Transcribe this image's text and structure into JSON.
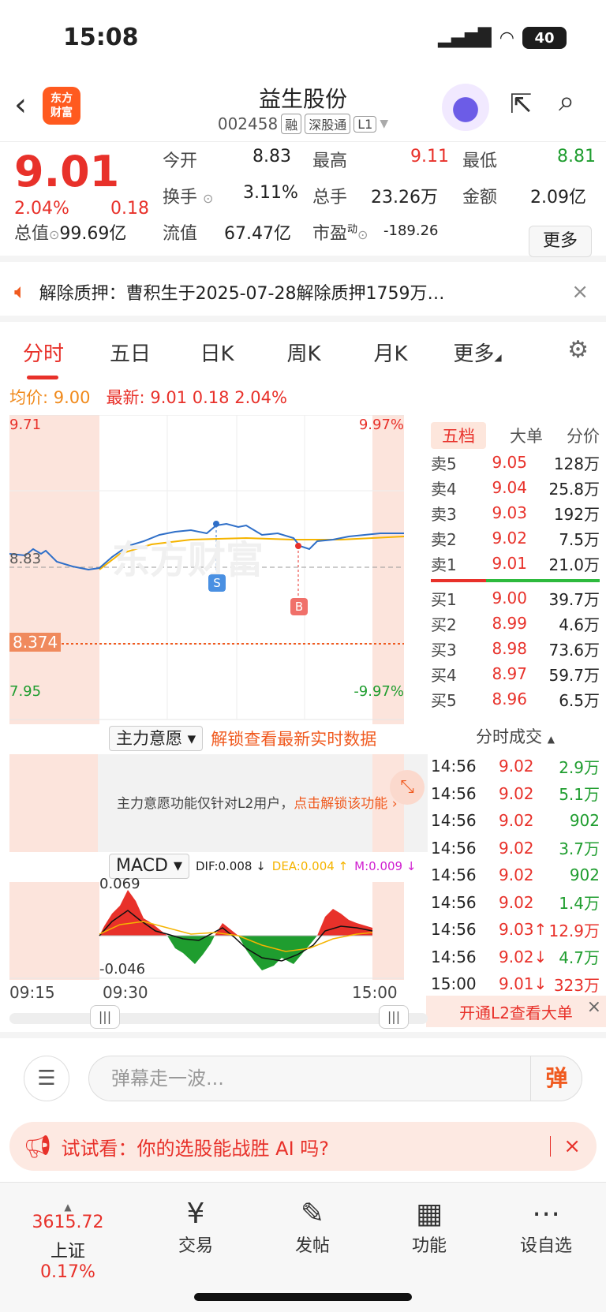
{
  "status": {
    "time": "15:08",
    "battery": "40"
  },
  "header": {
    "back_icon": "chevron-left-icon",
    "logo_text": "东方财富",
    "title": "益生股份",
    "code": "002458",
    "tags": [
      "融",
      "深股通",
      "L1"
    ]
  },
  "quote": {
    "price": "9.01",
    "pct": "2.04%",
    "change": "0.18",
    "open_label": "今开",
    "open": "8.83",
    "high_label": "最高",
    "high": "9.11",
    "low_label": "最低",
    "low": "8.81",
    "turnover_label": "换手",
    "turnover": "3.11%",
    "volume_label": "总手",
    "volume": "23.26万",
    "amount_label": "金额",
    "amount": "2.09亿",
    "mktcap_label": "总值",
    "mktcap": "99.69亿",
    "float_label": "流值",
    "float": "67.47亿",
    "pe_label": "市盈",
    "pe_sup": "动",
    "pe": "-189.26",
    "more_label": "更多"
  },
  "notice": {
    "text": "解除质押：曹积生于2025-07-28解除质押1759万…",
    "close": "×"
  },
  "tabs": [
    "分时",
    "五日",
    "日K",
    "周K",
    "月K",
    "更多"
  ],
  "avg": {
    "avg_label": "均价:",
    "avg": "9.00",
    "last_label": "最新:",
    "last": "9.01",
    "chg": "0.18",
    "pct": "2.04%"
  },
  "chart_labels": {
    "top_left": "9.71",
    "top_right": "9.97%",
    "bottom_left": "7.95",
    "bottom_right": "-9.97%",
    "pre_close": "8.83",
    "cost_line": "8.374",
    "s_mark": "S",
    "b_mark": "B"
  },
  "book": {
    "tabs": [
      "五档",
      "大单",
      "分价"
    ],
    "sells": [
      {
        "k": "卖5",
        "p": "9.05",
        "v": "128万"
      },
      {
        "k": "卖4",
        "p": "9.04",
        "v": "25.8万"
      },
      {
        "k": "卖3",
        "p": "9.03",
        "v": "192万"
      },
      {
        "k": "卖2",
        "p": "9.02",
        "v": "7.5万"
      },
      {
        "k": "卖1",
        "p": "9.01",
        "v": "21.0万"
      }
    ],
    "buys": [
      {
        "k": "买1",
        "p": "9.00",
        "v": "39.7万"
      },
      {
        "k": "买2",
        "p": "8.99",
        "v": "4.6万"
      },
      {
        "k": "买3",
        "p": "8.98",
        "v": "73.6万"
      },
      {
        "k": "买4",
        "p": "8.97",
        "v": "59.7万"
      },
      {
        "k": "买5",
        "p": "8.96",
        "v": "6.5万"
      }
    ]
  },
  "trades": {
    "title": "分时成交",
    "rows": [
      {
        "t": "14:56",
        "p": "9.02",
        "v": "2.9万",
        "c": "green"
      },
      {
        "t": "14:56",
        "p": "9.02",
        "v": "5.1万",
        "c": "green"
      },
      {
        "t": "14:56",
        "p": "9.02",
        "v": "902",
        "c": "green"
      },
      {
        "t": "14:56",
        "p": "9.02",
        "v": "3.7万",
        "c": "green"
      },
      {
        "t": "14:56",
        "p": "9.02",
        "v": "902",
        "c": "green"
      },
      {
        "t": "14:56",
        "p": "9.02",
        "v": "1.4万",
        "c": "green"
      },
      {
        "t": "14:56",
        "p": "9.03↑",
        "v": "12.9万",
        "c": "red"
      },
      {
        "t": "14:56",
        "p": "9.02↓",
        "v": "4.7万",
        "c": "green"
      },
      {
        "t": "15:00",
        "p": "9.01↓",
        "v": "323万",
        "c": "red"
      }
    ],
    "l2": "开通L2查看大单"
  },
  "zlys": {
    "dropdown": "主力意愿",
    "unlock": "解锁查看最新实时数据",
    "msg": "主力意愿功能仅针对L2用户，",
    "msg_link": "点击解锁该功能"
  },
  "macd": {
    "dropdown": "MACD",
    "dif": "DIF:0.008 ↓",
    "dea": "DEA:0.004 ↑",
    "m": "M:0.009 ↓",
    "top": "0.069",
    "bottom": "-0.046"
  },
  "times": {
    "t1": "09:15",
    "t2": "09:30",
    "t3": "15:00"
  },
  "danmu": {
    "placeholder": "弹幕走一波...",
    "btn": "弹"
  },
  "promo": {
    "text": "试试看：你的选股能战胜 AI 吗?",
    "close": "×"
  },
  "bottom": {
    "index_value": "3615.72",
    "index_name": "上证",
    "index_pct": "0.17%",
    "nav": [
      {
        "label": "交易",
        "icon": "¥"
      },
      {
        "label": "发帖",
        "icon": "✎"
      },
      {
        "label": "功能",
        "icon": "▦"
      },
      {
        "label": "设自选",
        "icon": "⋯"
      }
    ]
  }
}
